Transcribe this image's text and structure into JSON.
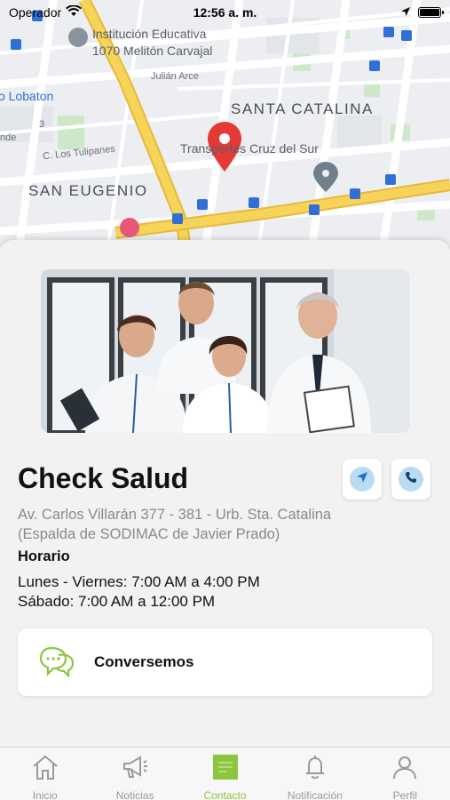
{
  "status_bar": {
    "carrier": "Operador",
    "time": "12:56 a. m."
  },
  "map": {
    "labels": {
      "institution_line1": "Institución Educativa",
      "institution_line2": "1070 Melitón Carvajal",
      "julian_arce": "Julián Arce",
      "lobaton": "o Lobaton",
      "santa_catalina": "SANTA CATALINA",
      "number_3": "3",
      "nde": "nde",
      "los_tulipanes": "C. Los Tulipanes",
      "transportes": "Transportes Cruz del Sur",
      "san_eugenio": "SAN EUGENIO"
    }
  },
  "location": {
    "name": "Check Salud",
    "address_line1": "Av. Carlos Villarán 377 - 381 - Urb. Sta. Catalina",
    "address_line2": "(Espalda de SODIMAC de Javier Prado)",
    "schedule_title": "Horario",
    "schedule_weekdays": "Lunes - Viernes: 7:00 AM a 4:00 PM",
    "schedule_saturday": "Sábado: 7:00 AM a 12:00 PM"
  },
  "chat": {
    "label": "Conversemos"
  },
  "tabbar": {
    "tabs": [
      {
        "label": "Inicio",
        "icon": "home-icon"
      },
      {
        "label": "Noticias",
        "icon": "megaphone-icon"
      },
      {
        "label": "Contacto",
        "icon": "contact-icon"
      },
      {
        "label": "Notificación",
        "icon": "bell-icon"
      },
      {
        "label": "Perfil",
        "icon": "user-icon"
      }
    ],
    "active_index": 2
  },
  "colors": {
    "accent_green": "#8cc63f",
    "map_pin_red": "#e53935",
    "action_circle_blue": "#b9dcf3",
    "road_yellow": "#f6c945"
  }
}
